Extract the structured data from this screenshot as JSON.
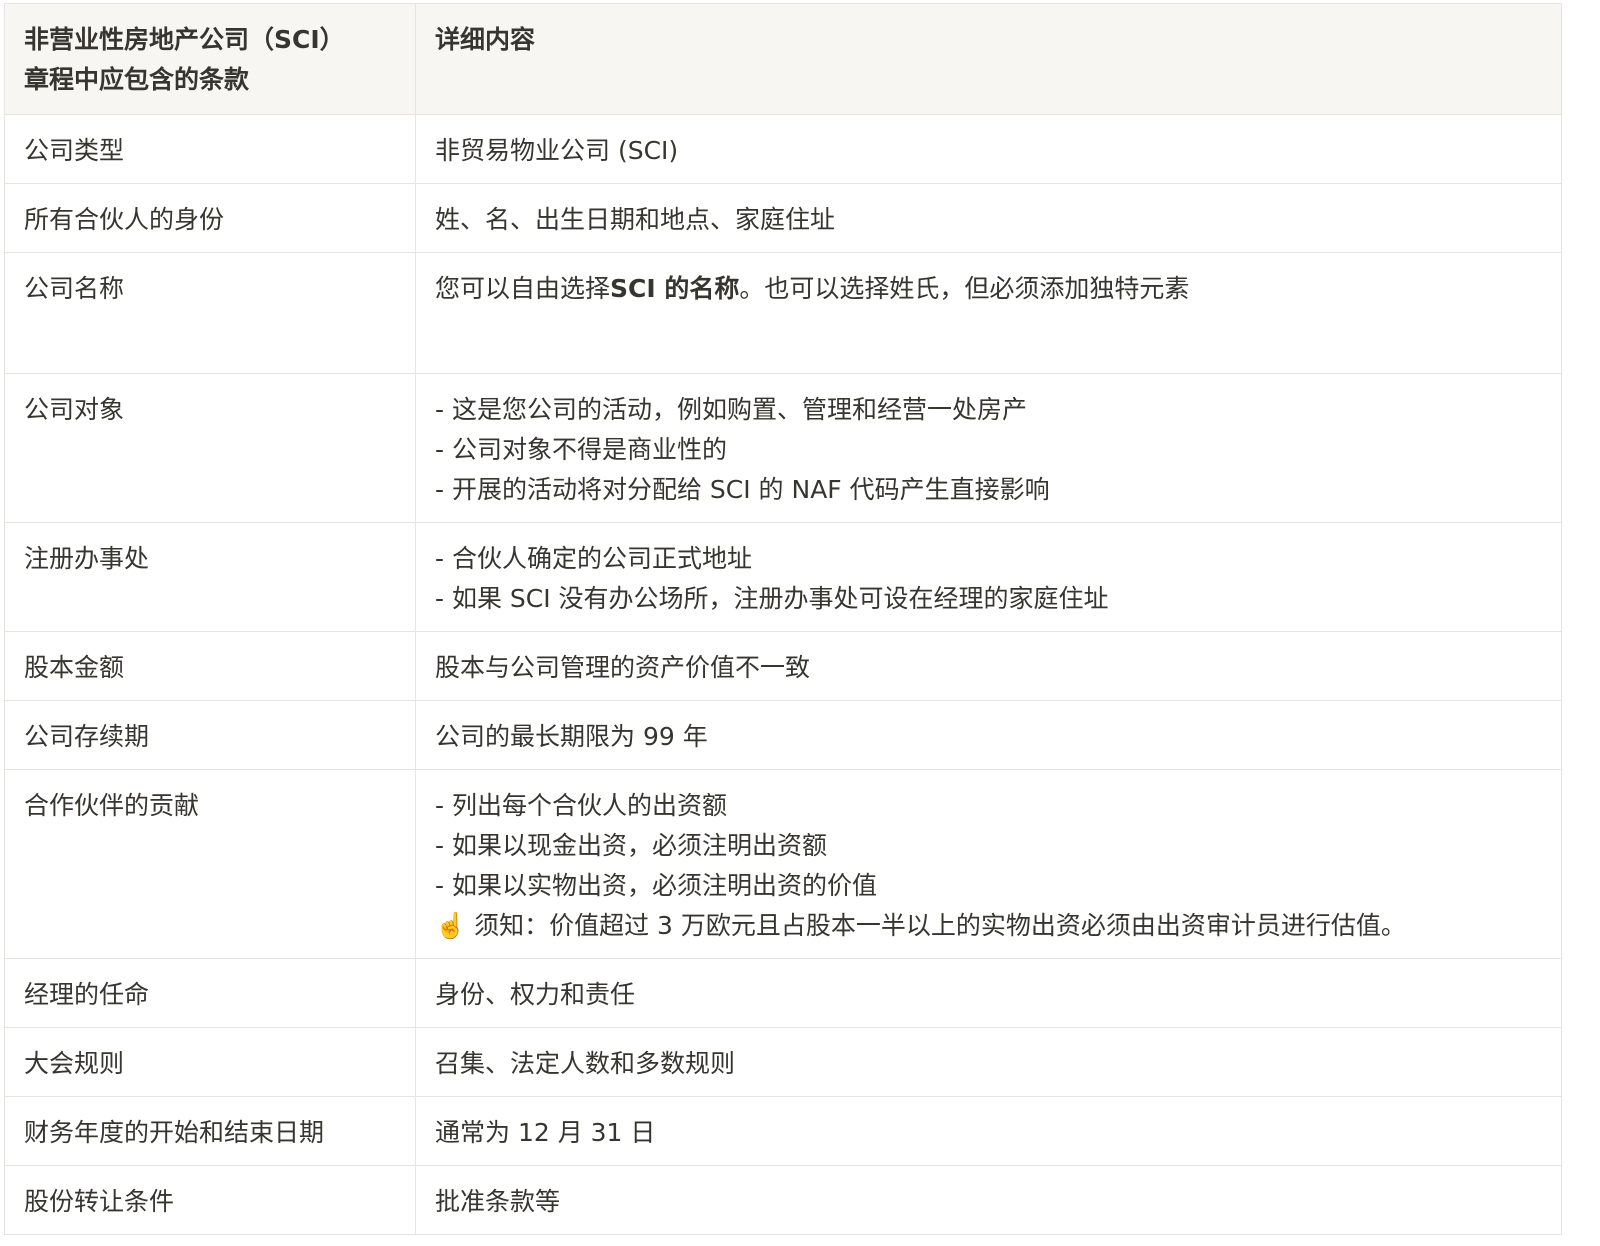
{
  "table": {
    "header": {
      "col1_line1": "非营业性房地产公司（SCI）",
      "col1_line2": "章程中应包含的条款",
      "col2": "详细内容"
    },
    "rows": [
      {
        "label": "公司类型",
        "lines": [
          "非贸易物业公司 (SCI)"
        ]
      },
      {
        "label": "所有合伙人的身份",
        "lines": [
          "姓、名、出生日期和地点、家庭住址"
        ]
      },
      {
        "label": "公司名称",
        "detail_prefix": "您可以自由选择",
        "detail_bold": "SCI 的名称",
        "detail_suffix": "。也可以选择姓氏，但必须添加独特元素"
      },
      {
        "label": "公司对象",
        "lines": [
          "- 这是您公司的活动，例如购置、管理和经营一处房产",
          "- 公司对象不得是商业性的",
          "- 开展的活动将对分配给 SCI 的 NAF 代码产生直接影响"
        ]
      },
      {
        "label": "注册办事处",
        "lines": [
          "- 合伙人确定的公司正式地址",
          "- 如果 SCI 没有办公场所，注册办事处可设在经理的家庭住址"
        ]
      },
      {
        "label": "股本金额",
        "lines": [
          "股本与公司管理的资产价值不一致"
        ]
      },
      {
        "label": "公司存续期",
        "lines": [
          "公司的最长期限为 99 年"
        ]
      },
      {
        "label": "合作伙伴的贡献",
        "lines": [
          "- 列出每个合伙人的出资额",
          "- 如果以现金出资，必须注明出资额",
          "- 如果以实物出资，必须注明出资的价值"
        ],
        "note_emoji": "☝️",
        "note_text": "须知：价值超过 3 万欧元且占股本一半以上的实物出资必须由出资审计员进行估值。"
      },
      {
        "label": "经理的任命",
        "lines": [
          "身份、权力和责任"
        ]
      },
      {
        "label": "大会规则",
        "lines": [
          "召集、法定人数和多数规则"
        ]
      },
      {
        "label": "财务年度的开始和结束日期",
        "lines": [
          "通常为 12 月 31 日"
        ]
      },
      {
        "label": "股份转让条件",
        "lines": [
          "批准条款等"
        ]
      }
    ]
  }
}
